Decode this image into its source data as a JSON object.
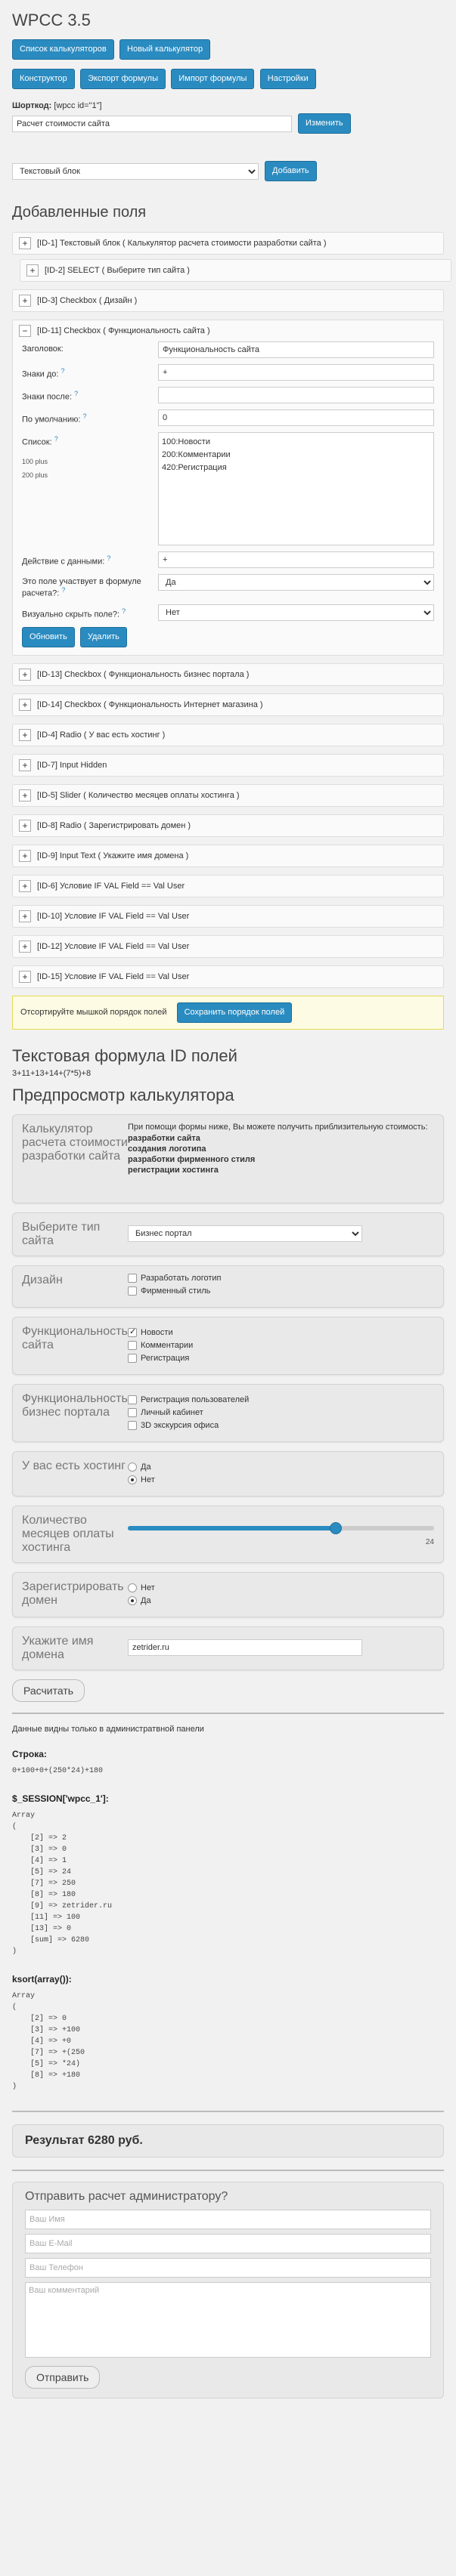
{
  "title": "WPCC 3.5",
  "top_buttons": [
    "Список калькуляторов",
    "Новый калькулятор"
  ],
  "nav_buttons": [
    "Конструктор",
    "Экспорт формулы",
    "Импорт формулы",
    "Настройки"
  ],
  "shortcode": {
    "label": "Шорткод:",
    "code": "[wpcc id=\"1\"]",
    "name_value": "Расчет стоимости сайта",
    "change_button": "Изменить"
  },
  "add_field": {
    "selected": "Текстовый блок",
    "button": "Добавить"
  },
  "fields_title": "Добавленные поля",
  "fields": [
    {
      "label": "[ID-1] Текстовый блок ( Калькулятор расчета стоимости разработки сайта )"
    },
    {
      "label": "[ID-2] SELECT ( Выберите тип сайта )"
    },
    {
      "label": "[ID-3] Checkbox ( Дизайн )"
    },
    {
      "label": "[ID-11] Checkbox ( Функциональность сайта )"
    }
  ],
  "edit_form": {
    "title_label": "Заголовок:",
    "title_value": "Функциональность сайта",
    "before_label": "Знаки до:",
    "before_value": "+",
    "after_label": "Знаки после:",
    "after_value": "",
    "default_label": "По умолчанию:",
    "default_value": "0",
    "list_label": "Список:",
    "list_side": [
      "100 plus",
      "200 plus"
    ],
    "list_items": [
      "100:Новости",
      "200:Комментарии",
      "420:Регистрация"
    ],
    "action_label": "Действие с данными:",
    "action_value": "+",
    "formula_label": "Это поле участвует в формуле расчета?:",
    "formula_value": "Да",
    "hide_label": "Визуально скрыть поле?:",
    "hide_value": "Нет",
    "hint_mark": "?",
    "save_button": "Обновить",
    "delete_button": "Удалить"
  },
  "fields_more": [
    {
      "label": "[ID-13] Checkbox ( Функциональность бизнес портала )"
    },
    {
      "label": "[ID-14] Checkbox ( Функциональность Интернет магазина )"
    },
    {
      "label": "[ID-4] Radio ( У вас есть хостинг )"
    },
    {
      "label": "[ID-7] Input Hidden"
    },
    {
      "label": "[ID-5] Slider ( Количество месяцев оплаты хостинга )"
    },
    {
      "label": "[ID-8] Radio ( Зарегистрировать домен )"
    },
    {
      "label": "[ID-9] Input Text ( Укажите имя домена )"
    },
    {
      "label": "[ID-6] Условие IF VAL Field == Val User"
    },
    {
      "label": "[ID-10] Условие IF VAL Field == Val User"
    },
    {
      "label": "[ID-12] Условие IF VAL Field == Val User"
    },
    {
      "label": "[ID-15] Условие IF VAL Field == Val User"
    }
  ],
  "sort_notice": {
    "text": "Отсортируйте мышкой порядок полей",
    "button": "Сохранить порядок полей"
  },
  "formula_title": "Текстовая формула ID полей",
  "formula": "3+11+13+14+(7*5)+8",
  "preview_title": "Предпросмотр калькулятора",
  "intro": {
    "q": "Калькулятор расчета стоимости разработки сайта",
    "text": "При помощи формы ниже, Вы можете получить приблизительную стоимость:",
    "items": [
      "разработки сайта",
      "создания логотипа",
      "разработки фирменного стиля",
      "регистрации хостинга"
    ]
  },
  "site_type": {
    "q": "Выберите тип сайта",
    "value": "Бизнес портал"
  },
  "design": {
    "q": "Дизайн",
    "options": [
      {
        "label": "Разработать логотип",
        "on": false
      },
      {
        "label": "Фирменный стиль",
        "on": false
      }
    ]
  },
  "func_site": {
    "q": "Функциональность сайта",
    "options": [
      {
        "label": "Новости",
        "on": true
      },
      {
        "label": "Комментарии",
        "on": false
      },
      {
        "label": "Регистрация",
        "on": false
      }
    ]
  },
  "func_portal": {
    "q": "Функциональность бизнес портала",
    "options": [
      {
        "label": "Регистрация пользователей",
        "on": false
      },
      {
        "label": "Личный кабинет",
        "on": false
      },
      {
        "label": "3D экскурсия офиса",
        "on": false
      }
    ]
  },
  "hosting": {
    "q": "У вас есть хостинг",
    "options": [
      {
        "label": "Да",
        "on": false
      },
      {
        "label": "Нет",
        "on": true
      }
    ]
  },
  "months": {
    "q": "Количество месяцев оплаты хостинга",
    "value": "24",
    "fraction": 0.68
  },
  "domain": {
    "q": "Зарегистрировать домен",
    "options": [
      {
        "label": "Нет",
        "on": false
      },
      {
        "label": "Да",
        "on": true
      }
    ]
  },
  "domain_name": {
    "q": "Укажите имя домена",
    "value": "zetrider.ru"
  },
  "calc_button": "Расчитать",
  "admin_note": "Данные видны только в администратвной панели",
  "debug": {
    "string_label": "Строка:",
    "string_value": "0+100+0+(250*24)+180",
    "session_label": "$_SESSION['wpcc_1']:",
    "session_dump": "Array\n(\n    [2] => 2\n    [3] => 0\n    [4] => 1\n    [5] => 24\n    [7] => 250\n    [8] => 180\n    [9] => zetrider.ru\n    [11] => 100\n    [13] => 0\n    [sum] => 6280\n)",
    "ksort_label": "ksort(array()):",
    "ksort_dump": "Array\n(\n    [2] => 0\n    [3] => +100\n    [4] => +0\n    [7] => +(250\n    [5] => *24)\n    [8] => +180\n)"
  },
  "result": "Результат 6280 руб.",
  "send": {
    "title": "Отправить расчет администратору?",
    "name_ph": "Ваш Имя",
    "email_ph": "Ваш E-Mail",
    "phone_ph": "Ваш Телефон",
    "comment_ph": "Ваш комментарий",
    "button": "Отправить"
  }
}
